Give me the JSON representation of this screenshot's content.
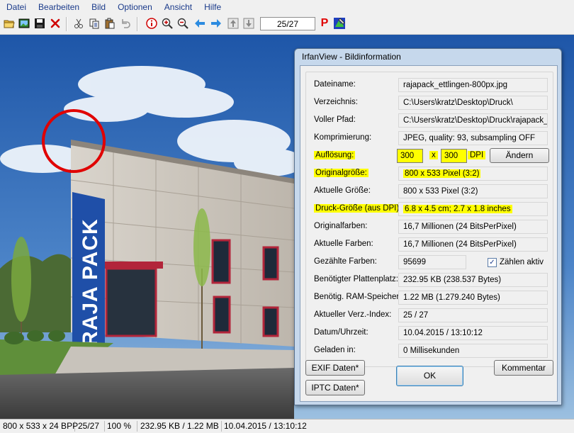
{
  "menu": [
    "Datei",
    "Bearbeiten",
    "Bild",
    "Optionen",
    "Ansicht",
    "Hilfe"
  ],
  "toolbar": {
    "icons": [
      "open-folder-icon",
      "slideshow-icon",
      "save-icon",
      "delete-icon",
      "cut-icon",
      "copy-icon",
      "paste-icon",
      "undo-icon",
      "info-icon",
      "zoom-in-icon",
      "zoom-out-icon",
      "previous-arrow-icon",
      "next-arrow-icon",
      "first-image-icon",
      "last-image-icon",
      "print-icon",
      "paint-icon"
    ],
    "page_counter": "25/27",
    "print_glyph": "P"
  },
  "dialog": {
    "title": "IrfanView - Bildinformation",
    "rows": [
      {
        "label": "Dateiname:",
        "value": "rajapack_ettlingen-800px.jpg"
      },
      {
        "label": "Verzeichnis:",
        "value": "C:\\Users\\kratz\\Desktop\\Druck\\"
      },
      {
        "label": "Voller Pfad:",
        "value": "C:\\Users\\kratz\\Desktop\\Druck\\rajapack_e"
      },
      {
        "label": "Komprimierung:",
        "value": "JPEG, quality: 93, subsampling OFF"
      },
      {
        "label": "Auflösung:",
        "value": ""
      },
      {
        "label": "Originalgröße:",
        "value": "800 x 533  Pixel (3:2)"
      },
      {
        "label": "Aktuelle Größe:",
        "value": "800 x 533  Pixel (3:2)"
      },
      {
        "label": "Druck-Größe (aus DPI):",
        "value": "6.8 x 4.5 cm; 2.7 x 1.8 inches"
      },
      {
        "label": "Originalfarben:",
        "value": "16,7 Millionen   (24 BitsPerPixel)"
      },
      {
        "label": "Aktuelle Farben:",
        "value": "16,7 Millionen   (24 BitsPerPixel)"
      },
      {
        "label": "Gezählte Farben:",
        "value": "95699"
      },
      {
        "label": "Benötigter Plattenplatz:",
        "value": "232.95 KB (238.537 Bytes)"
      },
      {
        "label": "Benötig. RAM-Speicher:",
        "value": "1.22  MB (1.279.240 Bytes)"
      },
      {
        "label": "Aktueller Verz.-Index:",
        "value": "25  /  27"
      },
      {
        "label": "Datum/Uhrzeit:",
        "value": "10.04.2015 / 13:10:12"
      },
      {
        "label": "Geladen in:",
        "value": "0 Millisekunden"
      }
    ],
    "resolution": {
      "x": "300",
      "sep": "x",
      "y": "300",
      "unit": "DPI",
      "change_button": "Ändern"
    },
    "count_colors_label": "Zählen aktiv",
    "count_colors_checked": true,
    "buttons": {
      "exif": "EXIF Daten*",
      "iptc": "IPTC Daten*",
      "ok": "OK",
      "comment": "Kommentar"
    }
  },
  "image": {
    "sign_text": "RAJA PACK",
    "annotation_color": "#e00000"
  },
  "status": [
    "800 x 533 x 24 BPP",
    "25/27",
    "100 %",
    "232.95 KB / 1.22 MB",
    "10.04.2015 / 13:10:12"
  ],
  "colors": {
    "highlight": "#ffff00",
    "sign_blue": "#1f4fa8",
    "menu_text": "#1a3a8a"
  }
}
